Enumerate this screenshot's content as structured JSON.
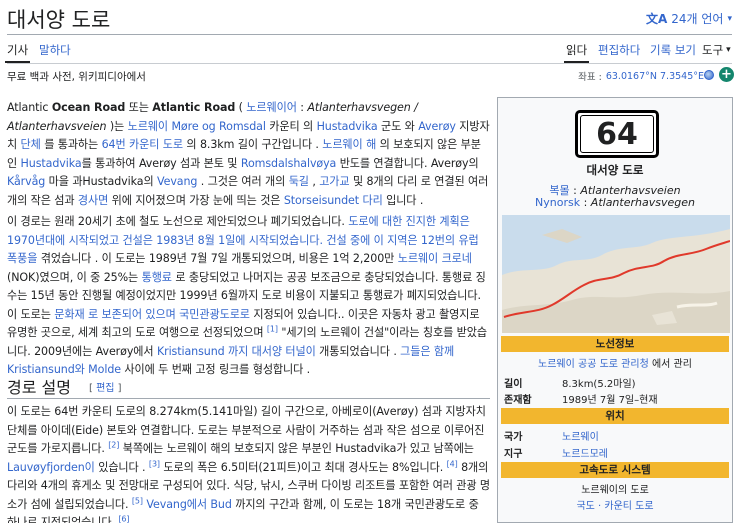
{
  "title": "대서양 도로",
  "languages": "24개 언어",
  "tabs": {
    "article": "기사",
    "talk": "말하다",
    "read": "읽다",
    "edit": "편집하다",
    "history": "기록 보기",
    "tools": "도구"
  },
  "tagline": "무료 백과 사전, 위키피디아에서",
  "coordinates": {
    "label": "좌표 :",
    "value": "63.0167°N 7.3545°E"
  },
  "para1": {
    "t1": "Atlantic ",
    "b1": "Ocean Road",
    "t2": " 또는 ",
    "b2": "Atlantic Road",
    "t3": " ( ",
    "l1": "노르웨이어",
    "t4": " : ",
    "i1": "Atlanterhavsvegen / Atlanterhavsveien",
    "t5": " )는",
    "l2": "노르웨이 Møre og Romsdal",
    "t6": " 카운티 의 ",
    "l3": "Hustadvika",
    "t7": " 군도 와 ",
    "l4": "Averøy",
    "t8": " 지방자치 ",
    "l5": "단체",
    "t9": " 를 통과하는 ",
    "l6": "64번 카운티 도로",
    "t10": " 의 8.3km 길이 구간입니다 . ",
    "l7": "노르웨이 해",
    "t11": " 의 보호되지 않은 부분 인 ",
    "l8": "Hustadvika",
    "t12": "를 통과하여 Averøy 섬과 본토 및 ",
    "l9": "Romsdalshalvøya",
    "t13": " 반도를 연결합니다. Averøy의 ",
    "l10": "Kårvåg",
    "t14": " 마을 과Hustadvika의 ",
    "l11": "Vevang",
    "t15": " . 그것은 여러 개의 ",
    "l12": "둑길",
    "t16": " , ",
    "l13": "고가교",
    "t17": " 및 8개의 다리 로 연결된 여러 개의 작은 섬과 ",
    "l14": "경사면",
    "t18": " 위에 지어졌으며 가장 눈에 띄는 것은 ",
    "l15": "Storseisundet 다리",
    "t19": " 입니다 ."
  },
  "para2": {
    "t1": "이 경로는 원래 20세기 초에 철도 노선으로 제안되었으나 폐기되었습니다. ",
    "l1": "도로에 대한 진지한 계획은 1970년대에 시작되었고 건설은 1983년 8월 1일에 시작되었습니다. 건설 중에 이 지역은 12번의 유럽 폭풍을",
    "t2": " 겪었습니다 . 이 도로는 1989년 7월 7일 개통되었으며, 비용은 1억 2,200만 ",
    "l2": "노르웨이 크로네",
    "t3": " (NOK)였으며, 이 중 25%는 ",
    "l3": "통행료",
    "t4": " 로 충당되었고 나머지는 공공 보조금으로 충당되었습니다. 통행료 징수는 15년 동안 진행될 예정이었지만 1999년 6월까지 도로 비용이 지불되고 통행료가 폐지되었습니다. 이 도로는 ",
    "l4": "문화재 로 보존되어 있으며 국민관광도로로",
    "t5": " 지정되어 있습니다.. 이곳은 자동차 광고 촬영지로 유명한 곳으로, 세계 최고의 도로 여행으로 선정되었으며 ",
    "r1": "[1]",
    "t6": " \"세기의 노르웨이 건설\"이라는 칭호를 받았습니다. 2009년에는 Averøy에서 ",
    "l5": "Kristiansund 까지 대서양 터널이",
    "t7": " 개통되었습니다 . ",
    "l6": "그들은 함께 Kristiansund와 Molde",
    "t8": " 사이에 두 번째 고정 링크를 형성합니다 ."
  },
  "section": {
    "heading": "경로 설명",
    "edit_open": "[ ",
    "edit_label": "편집",
    "edit_close": " ]"
  },
  "para3": {
    "t1": "이 도로는 64번 카운티 도로의 8.274km(5.141마일) 길이 구간으로, 아베로이(Averøy) 섬과 지방자치단체를 아이데(Eide) 본토와 연결합니다. 도로는 부분적으로 사람이 거주하는 섬과 작은 섬으로 이루어진 군도를 가로지릅니다. ",
    "r1": "[2]",
    "t2": " 북쪽에는 노르웨이 해의 보호되지 않은 부분인 Hustadvika가 있고 남쪽에는 ",
    "rl1": "Lauvøyfjorden이",
    "t3": " 있습니다 . ",
    "r2": "[3]",
    "t4": " 도로의 폭은 6.5미터(21피트)이고 최대 경사도는 8%입니다. ",
    "r3": "[4]",
    "t5": " 8개의 다리와 4개의 휴게소 및 전망대로 구성되어 있다. 식당, 낚시, 스쿠버 다이빙 리조트를 포함한 여러 관광 명소가 섬에 설립되었습니다. ",
    "r4": "[5]",
    "t6": " ",
    "l1": "Vevang에서 Bud",
    "t7": " 까지의 구간과 함께, 이 도로는 18개 국민관광도로 중 하나로 지정되었습니다. ",
    "r5": "[6]"
  },
  "infobox": {
    "shield_number": "64",
    "name": "대서양 도로",
    "alt1_label": "복몰",
    "alt1_sep": " : ",
    "alt1_value": "Atlanterhavsveien",
    "alt2_label": "Nynorsk",
    "alt2_sep": " : ",
    "alt2_value": "Atlanterhavsvegen",
    "route_info_header": "노선정보",
    "maintained_link": "노르웨이 공공 도로 관리청",
    "maintained_suffix": " 에서 관리",
    "length_label": "길이",
    "length_value": "8.3km(5.2마일)",
    "existed_label": "존재함",
    "existed_value": "1989년 7월 7일–현재",
    "location_header": "위치",
    "country_label": "국가",
    "country_value": "노르웨이",
    "region_label": "지구",
    "region_value": "노르드모레",
    "highway_header": "고속도로 시스템",
    "highway_line1": "노르웨이의 도로",
    "highway_line2": "국도 · 카운티 도로"
  },
  "colors": {
    "link": "#3366cc",
    "redlink": "#d73333",
    "infobox_header": "#f2b62e",
    "text": "#202122"
  }
}
